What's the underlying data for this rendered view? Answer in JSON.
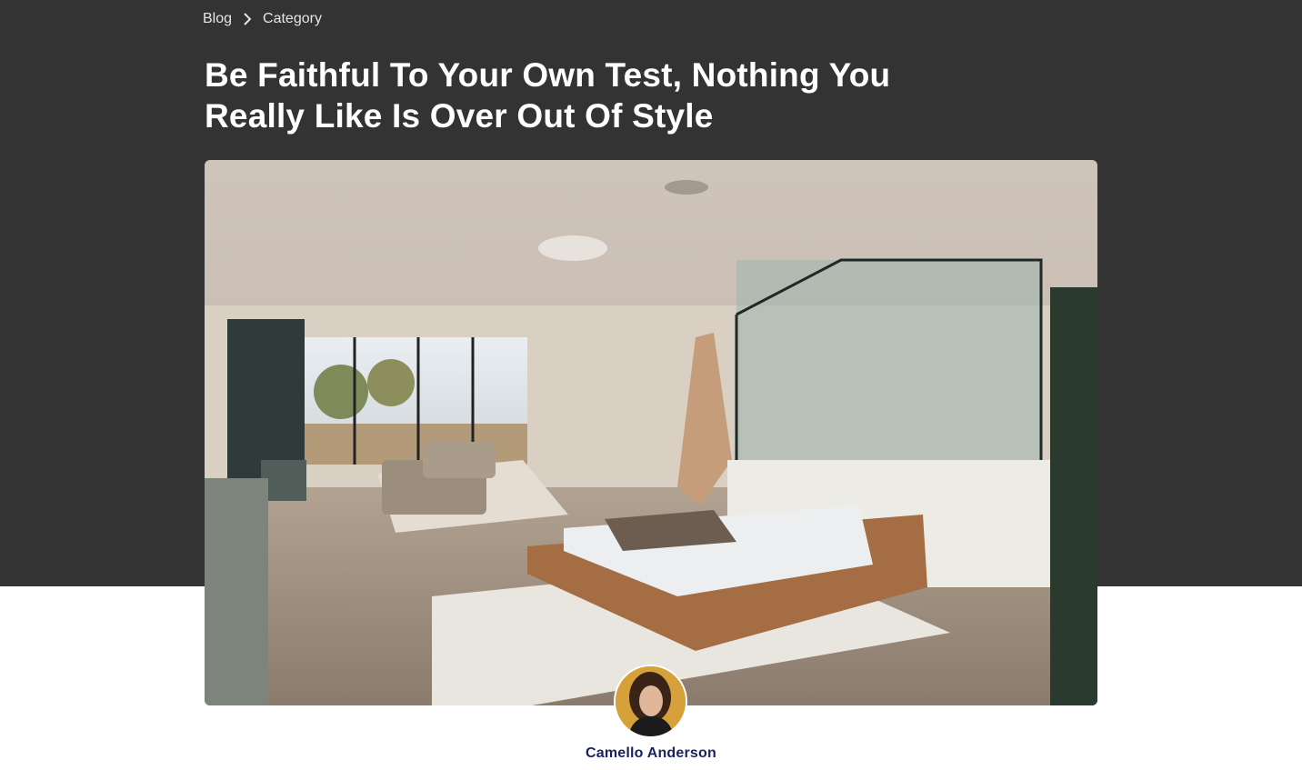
{
  "breadcrumb": {
    "items": [
      {
        "label": "Blog"
      },
      {
        "label": "Category"
      }
    ],
    "separator_icon": "chevron-right-icon"
  },
  "article": {
    "title": "Be Faithful To Your Own Test, Nothing You Really Like Is Over Out Of Style",
    "hero_image": "bedroom-interior-photo",
    "author": {
      "name": "Camello Anderson",
      "avatar": "author-avatar-photo"
    }
  },
  "colors": {
    "header_bg": "#333333",
    "page_bg": "#ffffff",
    "title_text": "#ffffff",
    "author_name": "#16235e"
  }
}
